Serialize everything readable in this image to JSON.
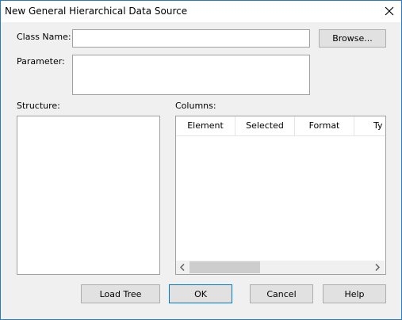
{
  "window": {
    "title": "New General Hierarchical Data Source"
  },
  "form": {
    "class_name_label": "Class Name:",
    "class_name_value": "",
    "browse_label": "Browse...",
    "parameter_label": "Parameter:",
    "parameter_value": "",
    "structure_label": "Structure:",
    "columns_label": "Columns:"
  },
  "columns_table": {
    "headers": [
      "Element",
      "Selected",
      "Format",
      "Ty"
    ]
  },
  "buttons": {
    "load_tree": "Load Tree",
    "ok": "OK",
    "cancel": "Cancel",
    "help": "Help"
  },
  "icons": {
    "close": "close-icon",
    "scroll_left": "chevron-left-icon",
    "scroll_right": "chevron-right-icon"
  },
  "colors": {
    "window_border": "#2b78c4",
    "default_button_border": "#0078d7",
    "dialog_background": "#f0f0f0"
  }
}
